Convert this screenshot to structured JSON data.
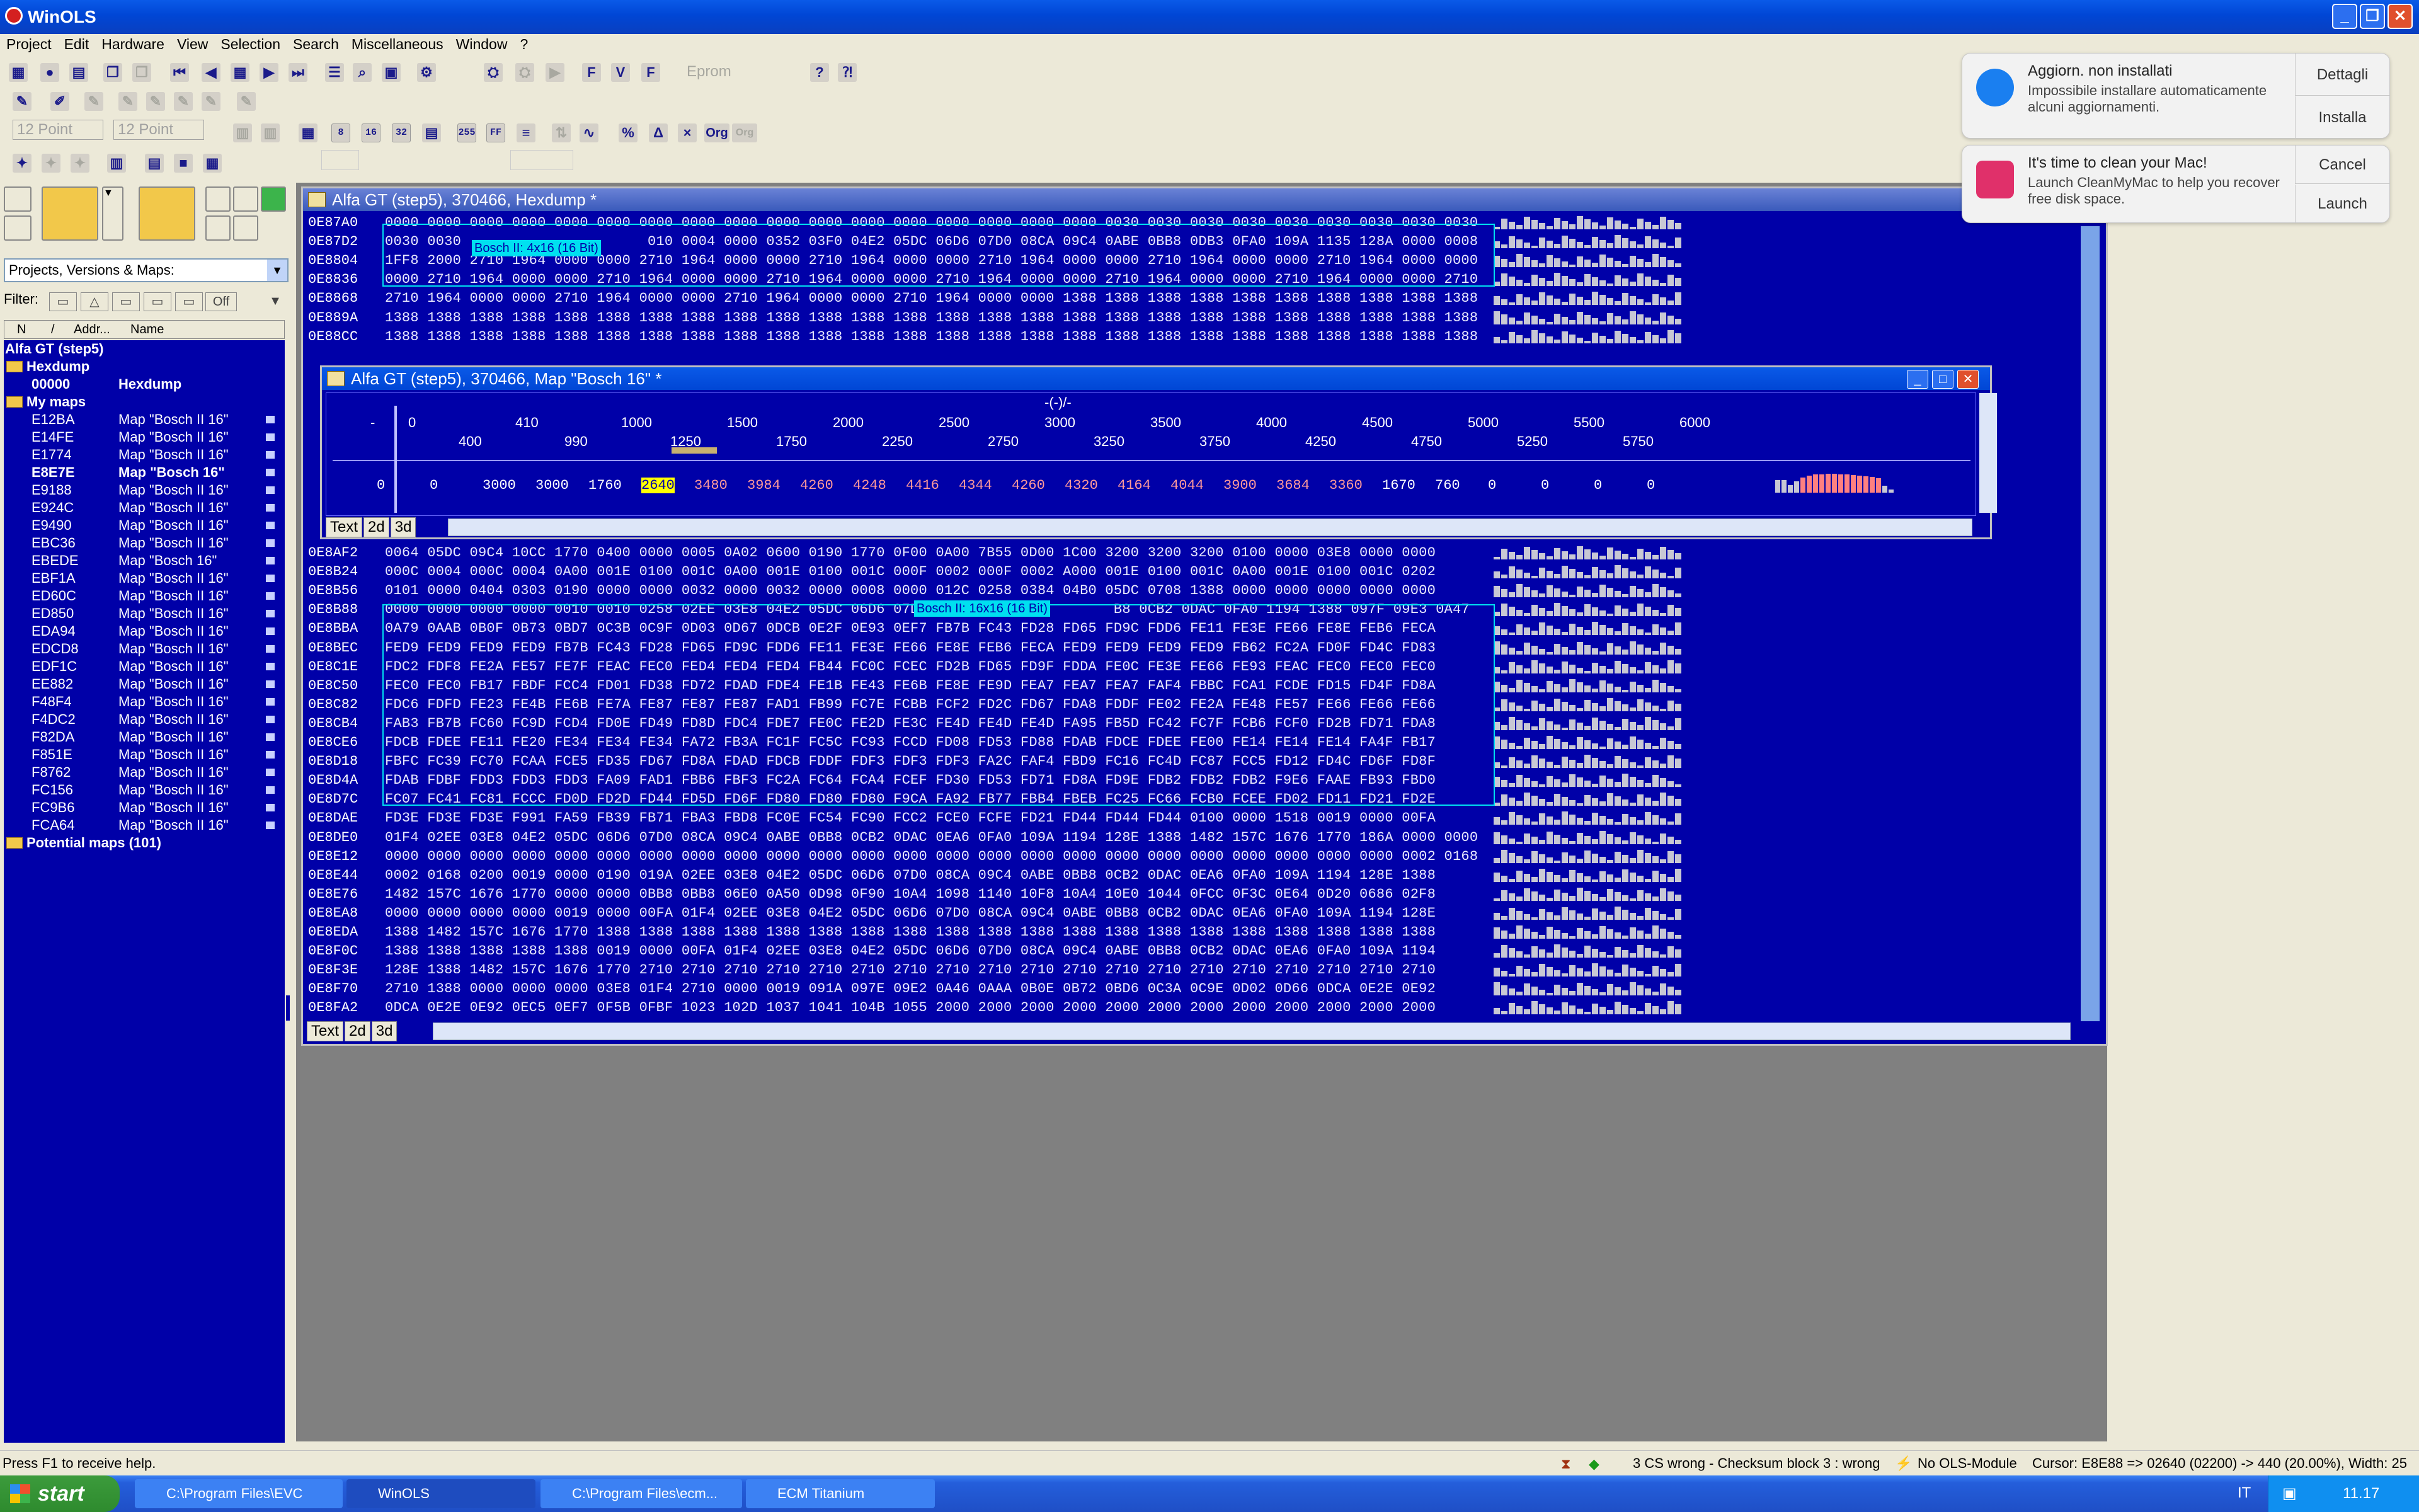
{
  "app": {
    "title": "WinOLS"
  },
  "menu": [
    "Project",
    "Edit",
    "Hardware",
    "View",
    "Selection",
    "Search",
    "Miscellaneous",
    "Window",
    "?"
  ],
  "toolbar": {
    "eprom": "Eprom",
    "font1": "12 Point",
    "font2": "12 Point",
    "num8": "8",
    "num16": "16",
    "num32": "32",
    "num255": "255",
    "ff": "FF",
    "org": "Org",
    "dec": "Org"
  },
  "left": {
    "dropdown": "Projects, Versions & Maps:",
    "filter_label": "Filter:",
    "filter_off": "Off",
    "col_n": "N",
    "col_addr": "Addr...",
    "col_name": "Name",
    "project": "Alfa GT (step5)",
    "hexdump_folder": "Hexdump",
    "hexdump_addr": "00000",
    "hexdump_name": "Hexdump",
    "mymaps": "My maps",
    "maps": [
      {
        "a": "E12BA",
        "n": "Map \"Bosch II 16\""
      },
      {
        "a": "E14FE",
        "n": "Map \"Bosch II 16\""
      },
      {
        "a": "E1774",
        "n": "Map \"Bosch II 16\""
      },
      {
        "a": "E8E7E",
        "n": "Map \"Bosch 16\""
      },
      {
        "a": "E9188",
        "n": "Map \"Bosch II 16\""
      },
      {
        "a": "E924C",
        "n": "Map \"Bosch II 16\""
      },
      {
        "a": "E9490",
        "n": "Map \"Bosch II 16\""
      },
      {
        "a": "EBC36",
        "n": "Map \"Bosch II 16\""
      },
      {
        "a": "EBEDE",
        "n": "Map \"Bosch 16\""
      },
      {
        "a": "EBF1A",
        "n": "Map \"Bosch II 16\""
      },
      {
        "a": "ED60C",
        "n": "Map \"Bosch II 16\""
      },
      {
        "a": "ED850",
        "n": "Map \"Bosch II 16\""
      },
      {
        "a": "EDA94",
        "n": "Map \"Bosch II 16\""
      },
      {
        "a": "EDCD8",
        "n": "Map \"Bosch II 16\""
      },
      {
        "a": "EDF1C",
        "n": "Map \"Bosch II 16\""
      },
      {
        "a": "EE882",
        "n": "Map \"Bosch II 16\""
      },
      {
        "a": "F48F4",
        "n": "Map \"Bosch II 16\""
      },
      {
        "a": "F4DC2",
        "n": "Map \"Bosch II 16\""
      },
      {
        "a": "F82DA",
        "n": "Map \"Bosch II 16\""
      },
      {
        "a": "F851E",
        "n": "Map \"Bosch II 16\""
      },
      {
        "a": "F8762",
        "n": "Map \"Bosch II 16\""
      },
      {
        "a": "FC156",
        "n": "Map \"Bosch II 16\""
      },
      {
        "a": "FC9B6",
        "n": "Map \"Bosch II 16\""
      },
      {
        "a": "FCA64",
        "n": "Map \"Bosch II 16\""
      }
    ],
    "potential": "Potential maps (101)"
  },
  "hex": {
    "title": "Alfa GT (step5), 370466, Hexdump *",
    "label1": "Bosch II: 4x16 (16 Bit)",
    "label2": "Bosch II: 16x16 (16 Bit)",
    "tabs": [
      "Text",
      "2d",
      "3d"
    ],
    "rows_top": [
      {
        "a": "0E87A0",
        "h": "0000 0000 0000 0000 0000 0000 0000 0000 0000 0000 0000 0000 0000 0000 0000 0000 0000 0030 0030 0030 0030 0030 0030 0030 0030 0030"
      },
      {
        "a": "0E87D2",
        "h": "0030 0030                      010 0004 0000 0352 03F0 04E2 05DC 06D6 07D0 08CA 09C4 0ABE 0BB8 0DB3 0FA0 109A 1135 128A 0000 0008"
      },
      {
        "a": "0E8804",
        "h": "1FF8 2000 2710 1964 0000 0000 2710 1964 0000 0000 2710 1964 0000 0000 2710 1964 0000 0000 2710 1964 0000 0000 2710 1964 0000 0000"
      },
      {
        "a": "0E8836",
        "h": "0000 2710 1964 0000 0000 2710 1964 0000 0000 2710 1964 0000 0000 2710 1964 0000 0000 2710 1964 0000 0000 2710 1964 0000 0000 2710"
      },
      {
        "a": "0E8868",
        "h": "2710 1964 0000 0000 2710 1964 0000 0000 2710 1964 0000 0000 2710 1964 0000 0000 1388 1388 1388 1388 1388 1388 1388 1388 1388 1388"
      },
      {
        "a": "0E889A",
        "h": "1388 1388 1388 1388 1388 1388 1388 1388 1388 1388 1388 1388 1388 1388 1388 1388 1388 1388 1388 1388 1388 1388 1388 1388 1388 1388"
      },
      {
        "a": "0E88CC",
        "h": "1388 1388 1388 1388 1388 1388 1388 1388 1388 1388 1388 1388 1388 1388 1388 1388 1388 1388 1388 1388 1388 1388 1388 1388 1388 1388"
      }
    ],
    "rows_bottom": [
      {
        "a": "0E8AF2",
        "h": "0064 05DC 09C4 10CC 1770 0400 0000 0005 0A02 0600 0190 1770 0F00 0A00 7B55 0D00 1C00 3200 3200 3200 0100 0000 03E8 0000 0000"
      },
      {
        "a": "0E8B24",
        "h": "000C 0004 000C 0004 0A00 001E 0100 001C 0A00 001E 0100 001C 000F 0002 000F 0002 A000 001E 0100 001C 0A00 001E 0100 001C 0202"
      },
      {
        "a": "0E8B56",
        "h": "0101 0000 0404 0303 0190 0000 0000 0032 0000 0032 0000 0008 0000 012C 0258 0384 04B0 05DC 0708 1388 0000 0000 0000 0000 0000"
      },
      {
        "a": "0E8B88",
        "h": "0000 0000 0000 0000 0010 0010 0258 02EE 03E8 04E2 05DC 06D6 07D0                      B8 0CB2 0DAC 0FA0 1194 1388 097F 09E3 0A47"
      },
      {
        "a": "0E8BBA",
        "h": "0A79 0AAB 0B0F 0B73 0BD7 0C3B 0C9F 0D03 0D67 0DCB 0E2F 0E93 0EF7 FB7B FC43 FD28 FD65 FD9C FDD6 FE11 FE3E FE66 FE8E FEB6 FECA"
      },
      {
        "a": "0E8BEC",
        "h": "FED9 FED9 FED9 FED9 FB7B FC43 FD28 FD65 FD9C FDD6 FE11 FE3E FE66 FE8E FEB6 FECA FED9 FED9 FED9 FED9 FB62 FC2A FD0F FD4C FD83"
      },
      {
        "a": "0E8C1E",
        "h": "FDC2 FDF8 FE2A FE57 FE7F FEAC FEC0 FED4 FED4 FED4 FB44 FC0C FCEC FD2B FD65 FD9F FDDA FE0C FE3E FE66 FE93 FEAC FEC0 FEC0 FEC0"
      },
      {
        "a": "0E8C50",
        "h": "FEC0 FEC0 FB17 FBDF FCC4 FD01 FD38 FD72 FDAD FDE4 FE1B FE43 FE6B FE8E FE9D FEA7 FEA7 FEA7 FAF4 FBBC FCA1 FCDE FD15 FD4F FD8A"
      },
      {
        "a": "0E8C82",
        "h": "FDC6 FDFD FE23 FE4B FE6B FE7A FE87 FE87 FE87 FAD1 FB99 FC7E FCBB FCF2 FD2C FD67 FDA8 FDDF FE02 FE2A FE48 FE57 FE66 FE66 FE66"
      },
      {
        "a": "0E8CB4",
        "h": "FAB3 FB7B FC60 FC9D FCD4 FD0E FD49 FD8D FDC4 FDE7 FE0C FE2D FE3C FE4D FE4D FE4D FA95 FB5D FC42 FC7F FCB6 FCF0 FD2B FD71 FDA8"
      },
      {
        "a": "0E8CE6",
        "h": "FDCB FDEE FE11 FE20 FE34 FE34 FE34 FA72 FB3A FC1F FC5C FC93 FCCD FD08 FD53 FD88 FDAB FDCE FDEE FE00 FE14 FE14 FE14 FA4F FB17"
      },
      {
        "a": "0E8D18",
        "h": "FBFC FC39 FC70 FCAA FCE5 FD35 FD67 FD8A FDAD FDCB FDDF FDF3 FDF3 FDF3 FA2C FAF4 FBD9 FC16 FC4D FC87 FCC5 FD12 FD4C FD6F FD8F"
      },
      {
        "a": "0E8D4A",
        "h": "FDAB FDBF FDD3 FDD3 FDD3 FA09 FAD1 FBB6 FBF3 FC2A FC64 FCA4 FCEF FD30 FD53 FD71 FD8A FD9E FDB2 FDB2 FDB2 F9E6 FAAE FB93 FBD0"
      },
      {
        "a": "0E8D7C",
        "h": "FC07 FC41 FC81 FCCC FD0D FD2D FD44 FD5D FD6F FD80 FD80 FD80 F9CA FA92 FB77 FBB4 FBEB FC25 FC66 FCB0 FCEE FD02 FD11 FD21 FD2E"
      },
      {
        "a": "0E8DAE",
        "h": "FD3E FD3E FD3E F991 FA59 FB39 FB71 FBA3 FBD8 FC0E FC54 FC90 FCC2 FCE0 FCFE FD21 FD44 FD44 FD44 0100 0000 1518 0019 0000 00FA"
      },
      {
        "a": "0E8DE0",
        "h": "01F4 02EE 03E8 04E2 05DC 06D6 07D0 08CA 09C4 0ABE 0BB8 0CB2 0DAC 0EA6 0FA0 109A 1194 128E 1388 1482 157C 1676 1770 186A 0000 0000"
      },
      {
        "a": "0E8E12",
        "h": "0000 0000 0000 0000 0000 0000 0000 0000 0000 0000 0000 0000 0000 0000 0000 0000 0000 0000 0000 0000 0000 0000 0000 0000 0002 0168"
      },
      {
        "a": "0E8E44",
        "h": "0002 0168 0200 0019 0000 0190 019A 02EE 03E8 04E2 05DC 06D6 07D0 08CA 09C4 0ABE 0BB8 0CB2 0DAC 0EA6 0FA0 109A 1194 128E 1388"
      },
      {
        "a": "0E8E76",
        "h": "1482 157C 1676 1770 0000 0000 0BB8 0BB8 06E0 0A50 0D98 0F90 10A4 1098 1140 10F8 10A4 10E0 1044 0FCC 0F3C 0E64 0D20 0686 02F8"
      },
      {
        "a": "0E8EA8",
        "h": "0000 0000 0000 0000 0019 0000 00FA 01F4 02EE 03E8 04E2 05DC 06D6 07D0 08CA 09C4 0ABE 0BB8 0CB2 0DAC 0EA6 0FA0 109A 1194 128E"
      },
      {
        "a": "0E8EDA",
        "h": "1388 1482 157C 1676 1770 1388 1388 1388 1388 1388 1388 1388 1388 1388 1388 1388 1388 1388 1388 1388 1388 1388 1388 1388 1388"
      },
      {
        "a": "0E8F0C",
        "h": "1388 1388 1388 1388 1388 0019 0000 00FA 01F4 02EE 03E8 04E2 05DC 06D6 07D0 08CA 09C4 0ABE 0BB8 0CB2 0DAC 0EA6 0FA0 109A 1194"
      },
      {
        "a": "0E8F3E",
        "h": "128E 1388 1482 157C 1676 1770 2710 2710 2710 2710 2710 2710 2710 2710 2710 2710 2710 2710 2710 2710 2710 2710 2710 2710 2710"
      },
      {
        "a": "0E8F70",
        "h": "2710 1388 0000 0000 0000 03E8 01F4 2710 0000 0019 091A 097E 09E2 0A46 0AAA 0B0E 0B72 0BD6 0C3A 0C9E 0D02 0D66 0DCA 0E2E 0E92"
      },
      {
        "a": "0E8FA2",
        "h": "0DCA 0E2E 0E92 0EC5 0EF7 0F5B 0FBF 1023 102D 1037 1041 104B 1055 2000 2000 2000 2000 2000 2000 2000 2000 2000 2000 2000 2000"
      }
    ]
  },
  "map": {
    "title": "Alfa GT (step5), 370466, Map \"Bosch 16\" *",
    "axis_title": "-(-)/-",
    "dash": "-",
    "zero": "0",
    "axis_top": [
      "410",
      "1000",
      "1500",
      "2000",
      "2500",
      "3000",
      "3500",
      "4000",
      "4500",
      "5000",
      "5500",
      "6000"
    ],
    "axis_bottom": [
      "400",
      "990",
      "1250",
      "1750",
      "2250",
      "2750",
      "3250",
      "3750",
      "4250",
      "4750",
      "5250",
      "5750"
    ],
    "values": [
      "0",
      "0",
      "3000",
      "3000",
      "1760",
      "2640",
      "3480",
      "3984",
      "4260",
      "4248",
      "4416",
      "4344",
      "4260",
      "4320",
      "4164",
      "4044",
      "3900",
      "3684",
      "3360",
      "1670",
      "760",
      "0",
      "0",
      "0",
      "0"
    ],
    "selected_index": 5,
    "tabs": [
      "Text",
      "2d",
      "3d"
    ]
  },
  "notif1": {
    "title": "Aggiorn. non installati",
    "body": "Impossibile installare automaticamente alcuni aggiornamenti.",
    "a1": "Dettagli",
    "a2": "Installa",
    "color": "#1a7ff0"
  },
  "notif2": {
    "title": "It's time to clean your Mac!",
    "body": "Launch CleanMyMac to help you recover free disk space.",
    "a1": "Cancel",
    "a2": "Launch",
    "color": "#e0306a"
  },
  "status": {
    "help": "Press F1 to receive help.",
    "cs": "3 CS wrong - Checksum block 3 : wrong",
    "ols": "No OLS-Module",
    "cursor": "Cursor: E8E88 => 02640 (02200) -> 440 (20.00%), Width: 25"
  },
  "taskbar": {
    "start": "start",
    "tasks": [
      "C:\\Program Files\\EVC",
      "WinOLS",
      "C:\\Program Files\\ecm...",
      "ECM Titanium"
    ],
    "lang": "IT",
    "time": "11.17"
  }
}
